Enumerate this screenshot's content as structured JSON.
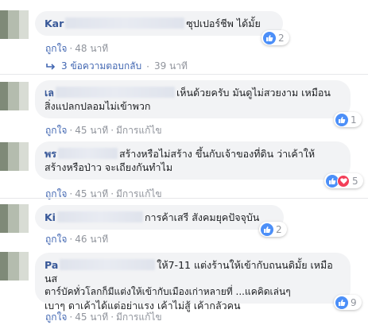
{
  "comments": [
    {
      "author": "Kar",
      "text": "ซุปเปอร์ชีพ ได้มั้ย",
      "like_label": "ถูกใจ",
      "time": "48 นาที",
      "reaction_count": "2"
    },
    {
      "author": "เล",
      "text_line1": "เห็นด้วยครับ มันดูไม่สวยงาม เหมือน",
      "text_line2": "สิ่งแปลกปลอมไม่เข้าพวก",
      "like_label": "ถูกใจ",
      "time": "45 นาที",
      "edited": "มีการแก้ไข",
      "reaction_count": "1"
    },
    {
      "author": "พร",
      "text_line1": "สร้างหรือไม่สร้าง ขึ้นกับเจ้าของที่ดิน ว่าเค้าให้",
      "text_line2": "สร้างหรือป่าว จะเถียงกันทำไม",
      "like_label": "ถูกใจ",
      "time": "45 นาที",
      "edited": "มีการแก้ไข",
      "reaction_count": "5"
    },
    {
      "author": "Ki",
      "text": "การค้าเสรี สังคมยุคปัจจุบัน",
      "like_label": "ถูกใจ",
      "time": "46 นาที",
      "reaction_count": "2"
    },
    {
      "author": "Pa",
      "text_line1": "ให้7-11 แต่งร้านให้เข้ากับถนนดิมั้ย เหมือนส",
      "text_line2": "ตาร์บัคทั่วโลกก็มีแต่งให้เข้ากับเมืองเก่าหลายที่ ...แคคิดเล่นๆ",
      "text_line3": "เบาๆ ดาเค้าได้แต่อย่าแรง เค้าไม่สู้ เค้ากลัวคน",
      "like_label": "ถูกใจ",
      "time": "45 นาที",
      "edited": "มีการแก้ไข",
      "reaction_count": "9"
    }
  ],
  "replies": {
    "label": "3 ข้อความตอบกลับ",
    "time": "39 นาที"
  },
  "colors": {
    "link": "#4267b2",
    "author": "#385898",
    "bubble": "#f2f3f5",
    "like": "#4c8ff8",
    "love": "#f33e58"
  }
}
